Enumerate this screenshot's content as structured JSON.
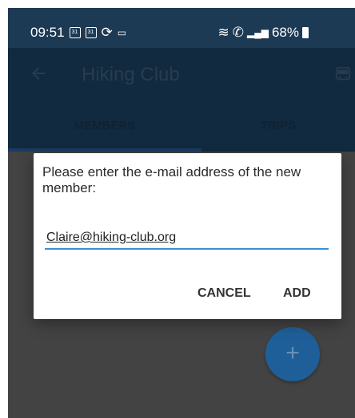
{
  "status_bar": {
    "time": "09:51",
    "notification_icons": [
      "calendar-31-icon",
      "calendar-31-icon",
      "sync-icon",
      "voicemail-icon"
    ],
    "battery": "68%",
    "right_icons": [
      "wifi-icon",
      "call-icon",
      "signal-icon",
      "battery-icon"
    ]
  },
  "app_bar": {
    "title": "Hiking Club",
    "back_icon": "arrow-left-icon",
    "action_icon": "bus-icon"
  },
  "tabs": [
    {
      "label": "MEMBERS",
      "selected": true
    },
    {
      "label": "TRIPS",
      "selected": false
    }
  ],
  "dialog": {
    "message": "Please enter the e-mail address of the new member:",
    "email_value": "Claire@hiking-club.org",
    "cancel_label": "CANCEL",
    "add_label": "ADD"
  },
  "fab": {
    "label": "+",
    "icon": "plus-icon"
  },
  "colors": {
    "status_bar": "#1d3a54",
    "app_bar": "#1f4d75",
    "accent": "#3b8fd6",
    "fab": "#1f5f99"
  }
}
